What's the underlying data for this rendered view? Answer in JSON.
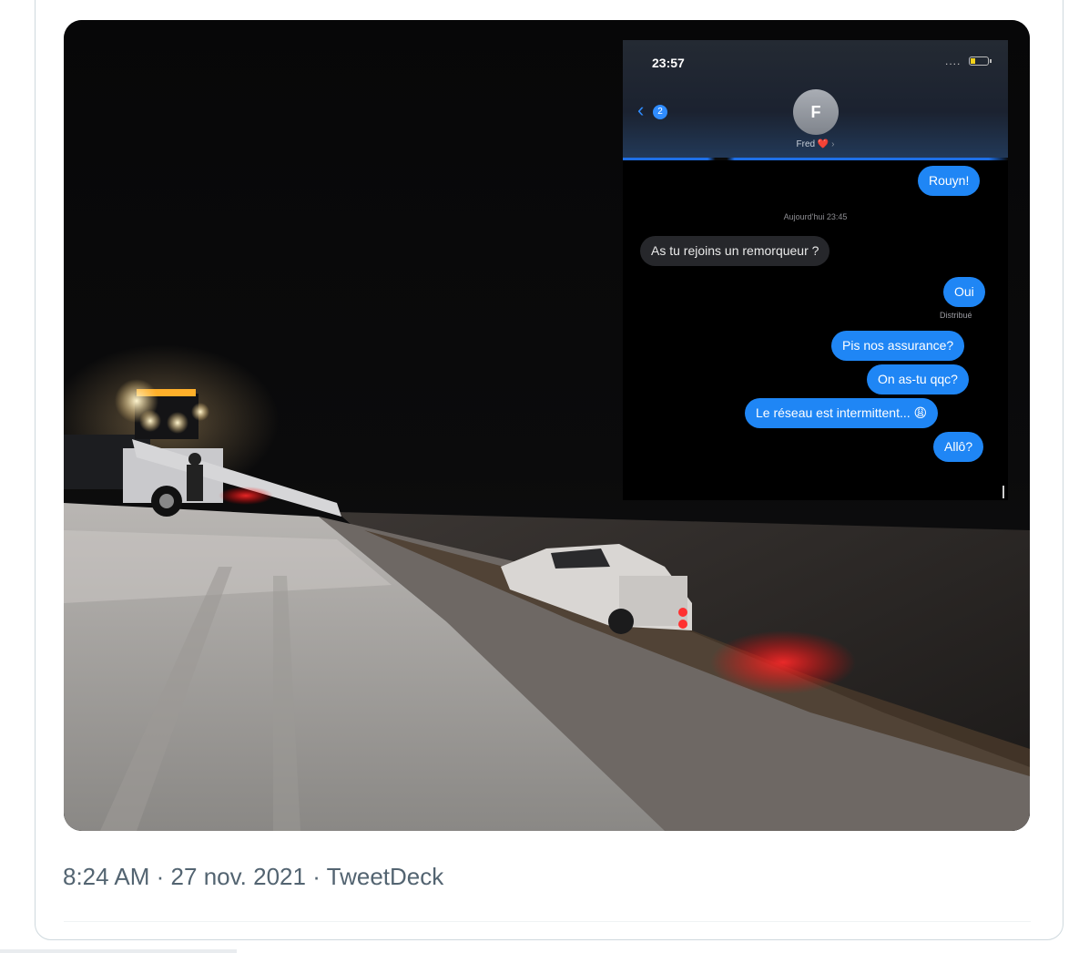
{
  "tweet": {
    "meta": {
      "time": "8:24 AM",
      "date": "27 nov. 2021",
      "source": "TweetDeck",
      "separator": "·"
    }
  },
  "screenshot": {
    "status_time": "23:57",
    "signal": "....",
    "back_badge": "2",
    "contact_initial": "F",
    "contact_name": "Fred",
    "heart": "❤️",
    "chevron": "›",
    "timestamp": "Aujourd'hui 23:45",
    "delivered": "Distribué",
    "messages": [
      {
        "text": "Rouyn!",
        "direction": "out"
      },
      {
        "text": "As tu rejoins un remorqueur ?",
        "direction": "in"
      },
      {
        "text": "Oui",
        "direction": "out"
      },
      {
        "text": "Pis nos assurance?",
        "direction": "out"
      },
      {
        "text": "On as-tu qqc?",
        "direction": "out"
      },
      {
        "text": "Le réseau est intermittent... 😩",
        "direction": "out"
      },
      {
        "text": "Allô?",
        "direction": "out"
      }
    ]
  },
  "colors": {
    "imessage_blue": "#1f86f5",
    "incoming_gray": "#26272b",
    "meta_text": "#536471",
    "card_border": "#cfd9de"
  }
}
